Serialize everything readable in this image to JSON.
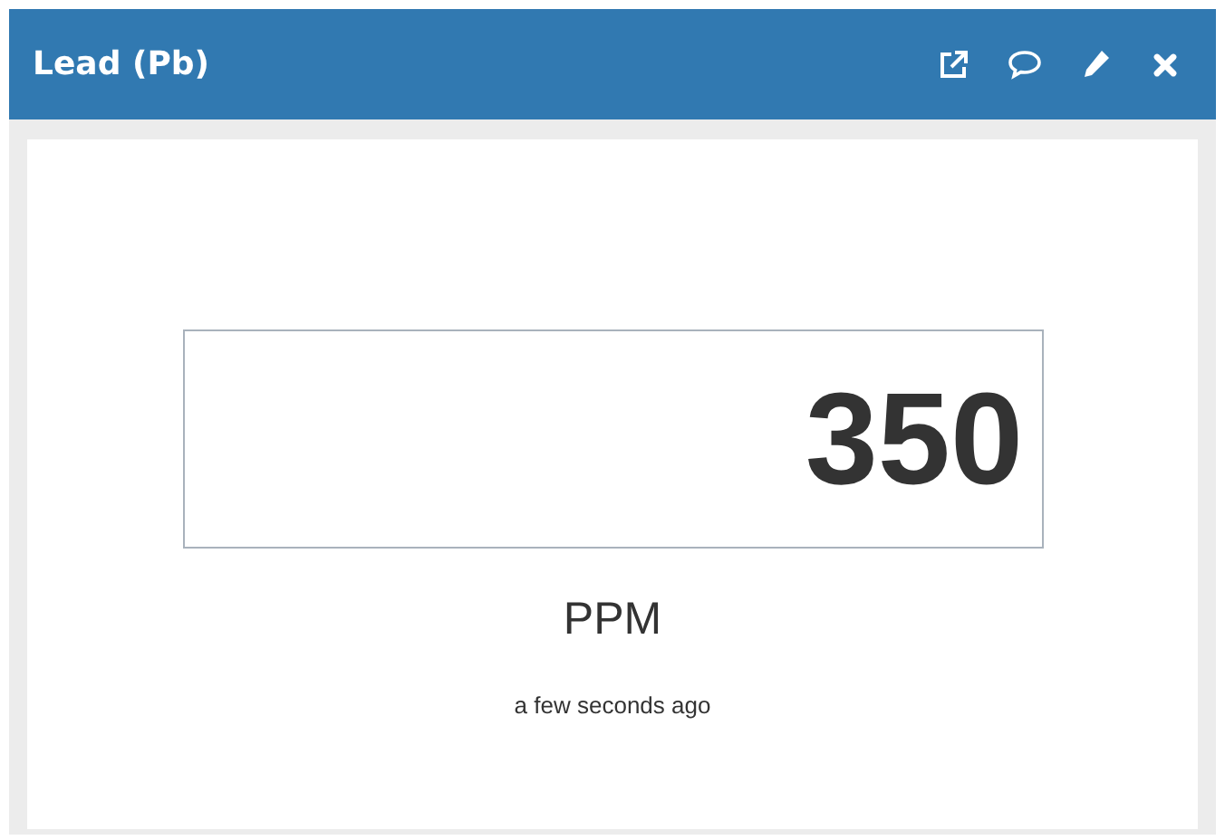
{
  "widget": {
    "title": "Lead (Pb)"
  },
  "reading": {
    "value": "350",
    "unit": "PPM",
    "updated": "a few seconds ago"
  }
}
